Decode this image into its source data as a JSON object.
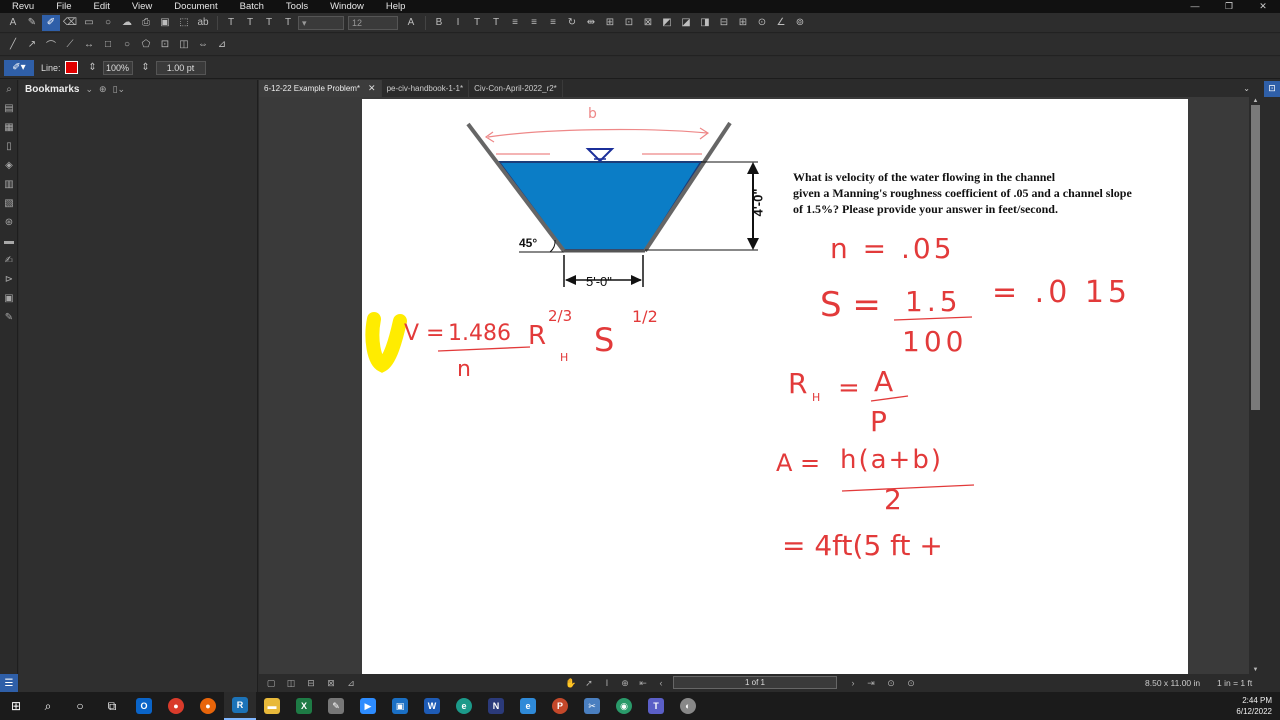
{
  "menubar": {
    "items": [
      "Revu",
      "File",
      "Edit",
      "View",
      "Document",
      "Batch",
      "Tools",
      "Window",
      "Help"
    ]
  },
  "toolbar": {
    "font_size": "12"
  },
  "properties": {
    "line_label": "Line:",
    "line_color": "#e00000",
    "opacity": "100%",
    "line_width": "1.00 pt"
  },
  "bookmarks": {
    "title": "Bookmarks"
  },
  "tabs": [
    {
      "label": "6-12-22 Example Problem*",
      "active": true
    },
    {
      "label": "pe-civ-handbook-1-1*",
      "active": false
    },
    {
      "label": "Civ-Con-April-2022_r2*",
      "active": false
    }
  ],
  "document": {
    "question_lines": [
      "What is velocity of the water flowing in the channel",
      "given a Manning's roughness coefficient of .05 and a channel slope",
      "of 1.5%? Please provide your answer in feet/second."
    ],
    "diagram": {
      "top_label": "b",
      "depth_label": "4'-0\"",
      "bottom_label": "5'-0\"",
      "angle_label": "45°"
    },
    "handwriting": {
      "n_line": "n = .05",
      "s_left": "S =",
      "s_num": "1.5",
      "s_den": "100",
      "s_right": "= .0 15",
      "rh_left": "R",
      "rh_sub": "H",
      "rh_eq": "=",
      "rh_num": "A",
      "rh_den": "P",
      "a_left": "A =",
      "a_num": "h(a+b)",
      "a_den": "2",
      "a_cont": "= 4ft(5 ft +",
      "v_left": "V =",
      "v_num": "1.486",
      "v_r": "R",
      "v_r_sub": "H",
      "v_r_exp": "2/3",
      "v_s": "S",
      "v_s_exp": "1/2",
      "v_den": "n"
    }
  },
  "statusbar": {
    "page": "1 of 1",
    "page_size": "8.50 x 11.00 in",
    "scale": "1 in = 1 ft"
  },
  "taskbar": {
    "time": "2:44 PM",
    "date": "6/12/2022"
  },
  "colors": {
    "accent": "#2f5fa8",
    "ink": "#e23a3a",
    "water": "#0b7dc6",
    "highlighter": "#ffec00"
  }
}
